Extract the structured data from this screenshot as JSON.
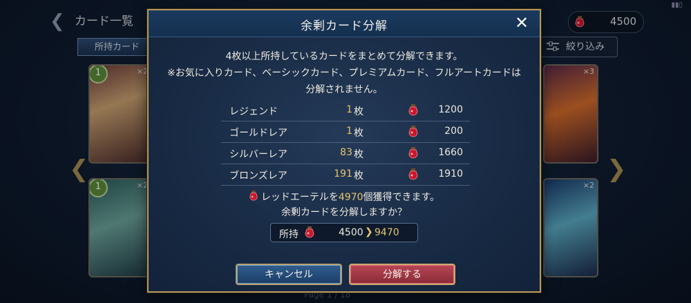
{
  "background": {
    "title": "カード一覧",
    "currency": "4500",
    "tab_label": "所持カード",
    "filter_label": "絞り込み",
    "pager": "Page 1 / 18",
    "cards": [
      {
        "count": "×2",
        "cost": "1"
      },
      {
        "count": "×3",
        "cost": ""
      },
      {
        "count": "×2",
        "cost": "1"
      },
      {
        "count": "×2",
        "cost": ""
      }
    ]
  },
  "dialog": {
    "title": "余剰カード分解",
    "close_icon": "close-icon",
    "desc_line1": "4枚以上所持しているカードをまとめて分解できます。",
    "desc_line2": "※お気に入りカード、ベーシックカード、プレミアムカード、フルアートカードは",
    "desc_line3": "分解されません。",
    "unit": "枚",
    "rows": [
      {
        "name": "レジェンド",
        "count": "1",
        "ether": "1200"
      },
      {
        "name": "ゴールドレア",
        "count": "1",
        "ether": "200"
      },
      {
        "name": "シルバーレア",
        "count": "83",
        "ether": "1660"
      },
      {
        "name": "ブロンズレア",
        "count": "191",
        "ether": "1910"
      }
    ],
    "gain_prefix": "レッドエーテルを",
    "gain_amount": "4970",
    "gain_suffix": "個獲得できます。",
    "confirm_question": "余剰カードを分解しますか？",
    "owned_label": "所持",
    "owned_from": "4500",
    "owned_to": "9470",
    "cancel_label": "キャンセル",
    "confirm_label": "分解する"
  },
  "colors": {
    "accent_gold": "#e8c56a",
    "frame_gold": "#b89a5c",
    "cancel_blue": "#2f5d8e",
    "confirm_red": "#b84655"
  }
}
